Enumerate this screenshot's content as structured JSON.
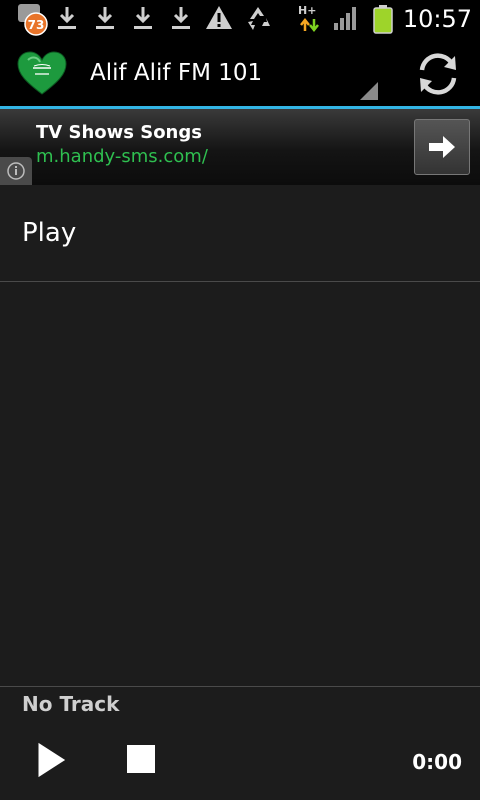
{
  "status_bar": {
    "time": "10:57",
    "notification_count": "73",
    "network_type": "H+",
    "icons": [
      "notification-badge-icon",
      "download-icon",
      "download-icon",
      "download-icon",
      "download-icon",
      "warning-icon",
      "recycle-icon",
      "network-activity-icon",
      "signal-icon",
      "battery-icon"
    ]
  },
  "action_bar": {
    "title": "Alif Alif FM 101",
    "logo_icon": "saudi-heart-logo-icon",
    "refresh_icon": "refresh-icon",
    "accent_color": "#33b5e5"
  },
  "ad": {
    "title": "TV Shows Songs",
    "url": "m.handy-sms.com/",
    "url_color": "#2fbf50",
    "info_icon": "info-icon",
    "arrow_icon": "arrow-right-icon"
  },
  "list": {
    "play_label": "Play"
  },
  "player": {
    "track": "No Track",
    "time": "0:00",
    "play_icon": "play-icon",
    "stop_icon": "stop-icon"
  }
}
